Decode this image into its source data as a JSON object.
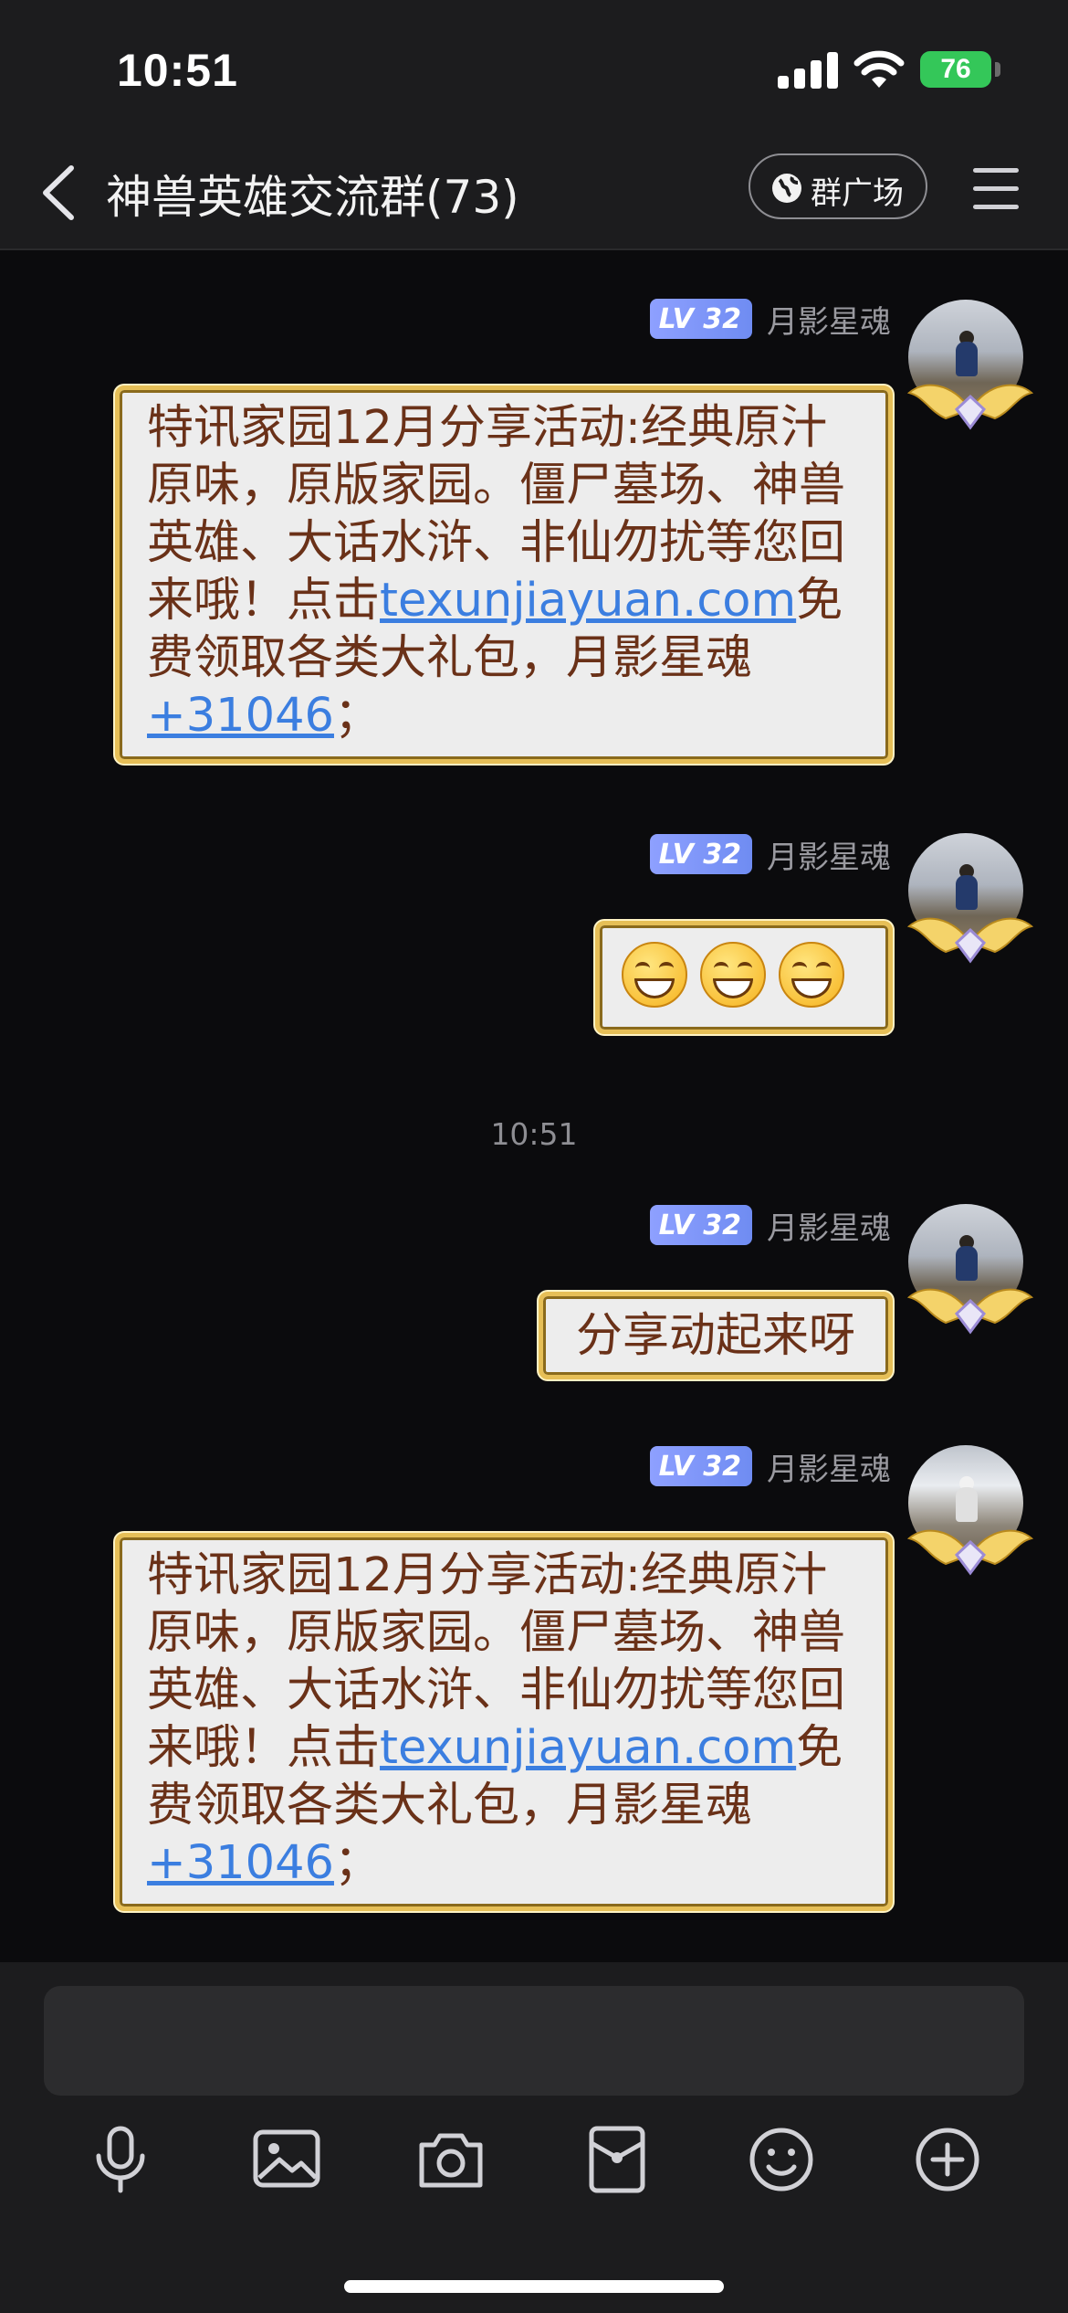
{
  "status_bar": {
    "time": "10:51",
    "battery": "76"
  },
  "header": {
    "title": "神兽英雄交流群(73)",
    "plaza_label": "群广场"
  },
  "messages": [
    {
      "level": "LV 32",
      "sender": "月影星魂",
      "text_before": "特讯家园12月分享活动:经典原汁原味，原版家园。僵尸墓场、神兽英雄、大话水浒、非仙勿扰等您回来哦！点击",
      "link": "texunjiayuan.com",
      "text_mid": "免费领取各类大礼包，月影星魂",
      "code": "+31046",
      "text_after": "；"
    },
    {
      "level": "LV 32",
      "sender": "月影星魂",
      "emoji_count": 3
    },
    {
      "level": "LV 32",
      "sender": "月影星魂",
      "text": "分享动起来呀"
    },
    {
      "level": "LV 32",
      "sender": "月影星魂",
      "text_before": "特讯家园12月分享活动:经典原汁原味，原版家园。僵尸墓场、神兽英雄、大话水浒、非仙勿扰等您回来哦！点击",
      "link": "texunjiayuan.com",
      "text_mid": "免费领取各类大礼包，月影星魂",
      "code": "+31046",
      "text_after": "；"
    }
  ],
  "timestamp": "10:51",
  "toolbar": [
    "microphone-icon",
    "image-icon",
    "camera-icon",
    "red-packet-icon",
    "emoji-icon",
    "add-icon"
  ],
  "colors": {
    "bubble_border": "#e6bf57",
    "bubble_text": "#6a3118",
    "link": "#3b7ee0",
    "level_badge": "#7f95f5"
  }
}
